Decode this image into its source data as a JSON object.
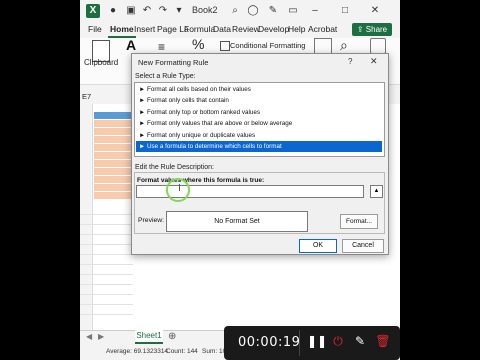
{
  "window": {
    "title": "Book2",
    "tabs": [
      "File",
      "Home",
      "Insert",
      "Page La",
      "Formula",
      "Data",
      "Review",
      "Develop",
      "Help",
      "Acrobat"
    ],
    "active_tab": "Home",
    "share_label": "Share"
  },
  "ribbon": {
    "clipboard_label": "Clipboard",
    "conditional_formatting_label": "Conditional Formatting"
  },
  "namebox": "E7",
  "dialog": {
    "title": "New Formatting Rule",
    "help": "?",
    "close": "✕",
    "select_rule_type_label": "Select a Rule Type:",
    "rule_types": [
      "► Format all cells based on their values",
      "► Format only cells that contain",
      "► Format only top or bottom ranked values",
      "► Format only values that are above or below average",
      "► Format only unique or duplicate values",
      "► Use a formula to determine which cells to format"
    ],
    "selected_rule_index": 5,
    "edit_description_label": "Edit the Rule Description:",
    "formula_label": "Format values where this formula is true:",
    "formula_value": "",
    "preview_label": "Preview:",
    "preview_text": "No Format Set",
    "format_button": "Format...",
    "ok_button": "OK",
    "cancel_button": "Cancel"
  },
  "sheet_tab": "Sheet1",
  "status": {
    "average": "Average: 69.1323314",
    "count": "Count: 144",
    "sum": "Sum: 107"
  },
  "recorder": {
    "timer": "00:00:19"
  },
  "colors": {
    "excel_green": "#1d6f42",
    "selection_blue": "#0b66d0",
    "cursor_ring": "#7ed957",
    "cell_orange": "#f8cbad"
  }
}
